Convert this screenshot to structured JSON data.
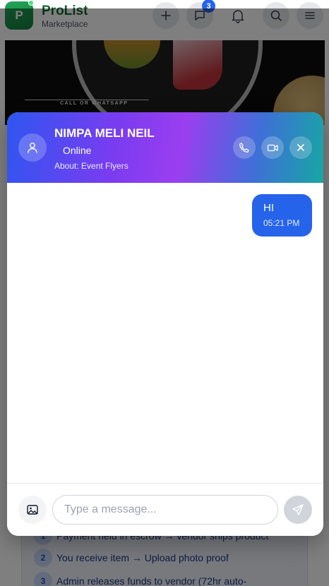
{
  "app": {
    "logo_letter": "P",
    "brand_name": "ProList",
    "brand_sub": "Marketplace",
    "messages_badge": "3"
  },
  "banner": {
    "whatsapp_text": "CALL OR WHATSAPP"
  },
  "background_steps": [
    {
      "num": "1",
      "text": "Payment held in escrow → vendor ships product"
    },
    {
      "num": "2",
      "text": "You receive item → Upload photo proof"
    },
    {
      "num": "3",
      "text": "Admin releases funds to vendor (72hr auto-"
    }
  ],
  "chat": {
    "contact_name": "NIMPA MELI NEIL",
    "status": "Online",
    "about": "About: Event Flyers",
    "messages": [
      {
        "text": "HI",
        "time": "05:21 PM",
        "from": "me"
      }
    ],
    "input_placeholder": "Type a message...",
    "input_value": ""
  },
  "colors": {
    "brand_green": "#166534",
    "accent_blue": "#2563eb",
    "header_gradient_start": "#2e56f0",
    "header_gradient_mid": "#9a3ef0",
    "header_gradient_end": "#17a7a3"
  },
  "icons": {
    "add": "plus-icon",
    "messages": "chat-icon",
    "notifications": "bell-icon",
    "search": "search-icon",
    "menu": "menu-icon",
    "avatar": "user-icon",
    "call": "phone-icon",
    "video": "video-icon",
    "close": "close-icon",
    "attach": "image-icon",
    "send": "send-icon"
  }
}
